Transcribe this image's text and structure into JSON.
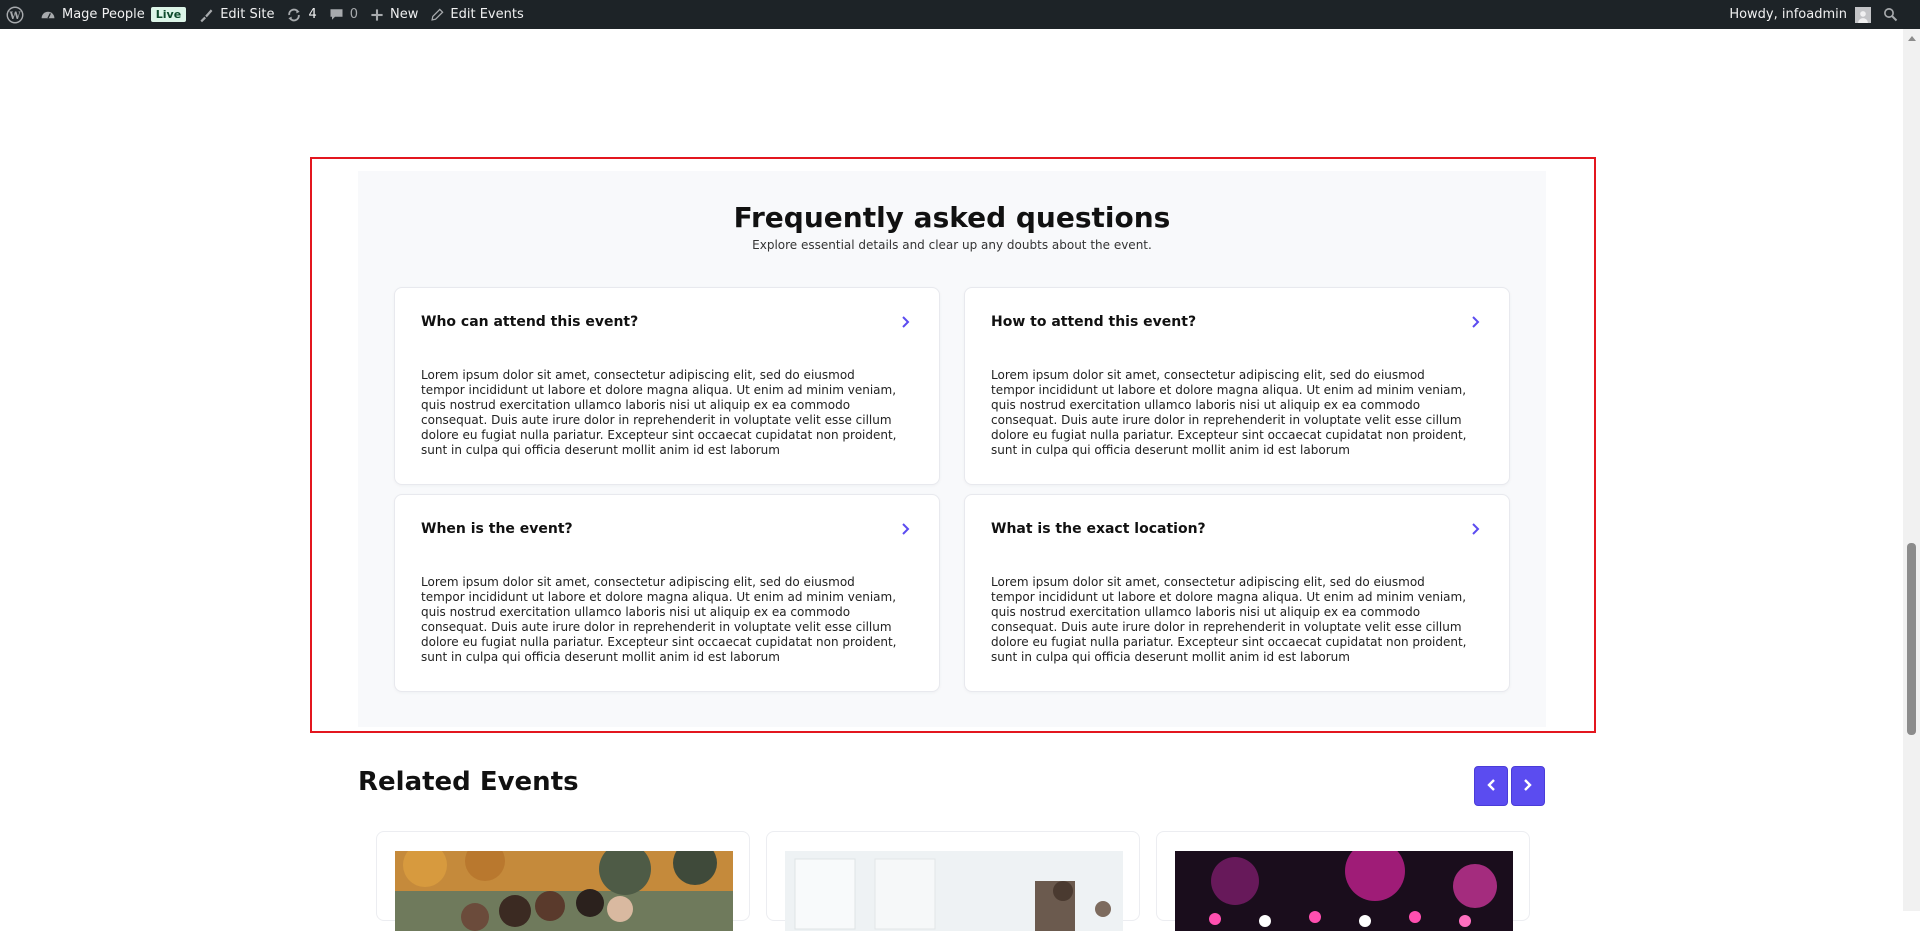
{
  "adminbar": {
    "site_name": "Mage People",
    "live_badge": "Live",
    "edit_site": "Edit Site",
    "updates_count": "4",
    "comments_count": "0",
    "new_label": "New",
    "edit_events": "Edit Events",
    "howdy": "Howdy, infoadmin"
  },
  "faq": {
    "title": "Frequently asked questions",
    "subtitle": "Explore essential details and clear up any doubts about the event.",
    "items": [
      {
        "question": "Who can attend this event?",
        "answer": "Lorem ipsum dolor sit amet, consectetur adipiscing elit, sed do eiusmod tempor incididunt ut labore et dolore magna aliqua. Ut enim ad minim veniam, quis nostrud exercitation ullamco laboris nisi ut aliquip ex ea commodo consequat. Duis aute irure dolor in reprehenderit in voluptate velit esse cillum dolore eu fugiat nulla pariatur. Excepteur sint occaecat cupidatat non proident, sunt in culpa qui officia deserunt mollit anim id est laborum"
      },
      {
        "question": "How to attend this event?",
        "answer": "Lorem ipsum dolor sit amet, consectetur adipiscing elit, sed do eiusmod tempor incididunt ut labore et dolore magna aliqua. Ut enim ad minim veniam, quis nostrud exercitation ullamco laboris nisi ut aliquip ex ea commodo consequat. Duis aute irure dolor in reprehenderit in voluptate velit esse cillum dolore eu fugiat nulla pariatur. Excepteur sint occaecat cupidatat non proident, sunt in culpa qui officia deserunt mollit anim id est laborum"
      },
      {
        "question": "When is the event?",
        "answer": "Lorem ipsum dolor sit amet, consectetur adipiscing elit, sed do eiusmod tempor incididunt ut labore et dolore magna aliqua. Ut enim ad minim veniam, quis nostrud exercitation ullamco laboris nisi ut aliquip ex ea commodo consequat. Duis aute irure dolor in reprehenderit in voluptate velit esse cillum dolore eu fugiat nulla pariatur. Excepteur sint occaecat cupidatat non proident, sunt in culpa qui officia deserunt mollit anim id est laborum"
      },
      {
        "question": "What is the exact location?",
        "answer": "Lorem ipsum dolor sit amet, consectetur adipiscing elit, sed do eiusmod tempor incididunt ut labore et dolore magna aliqua. Ut enim ad minim veniam, quis nostrud exercitation ullamco laboris nisi ut aliquip ex ea commodo consequat. Duis aute irure dolor in reprehenderit in voluptate velit esse cillum dolore eu fugiat nulla pariatur. Excepteur sint occaecat cupidatat non proident, sunt in culpa qui officia deserunt mollit anim id est laborum"
      }
    ]
  },
  "related": {
    "title": "Related Events"
  },
  "colors": {
    "accent": "#5b4cf0",
    "highlight_border": "#e3161f",
    "adminbar_bg": "#1d2327",
    "panel_bg": "#f8f9fb"
  },
  "icons": {
    "wp_logo": "wordpress-icon",
    "dashboard": "dashboard-icon",
    "edit_site": "brush-icon",
    "updates": "refresh-icon",
    "comments": "comment-icon",
    "new": "plus-icon",
    "edit": "pencil-icon",
    "search": "search-icon",
    "faq_chevron": "chevron-right-icon",
    "prev": "chevron-left-icon",
    "next": "chevron-right-icon"
  }
}
